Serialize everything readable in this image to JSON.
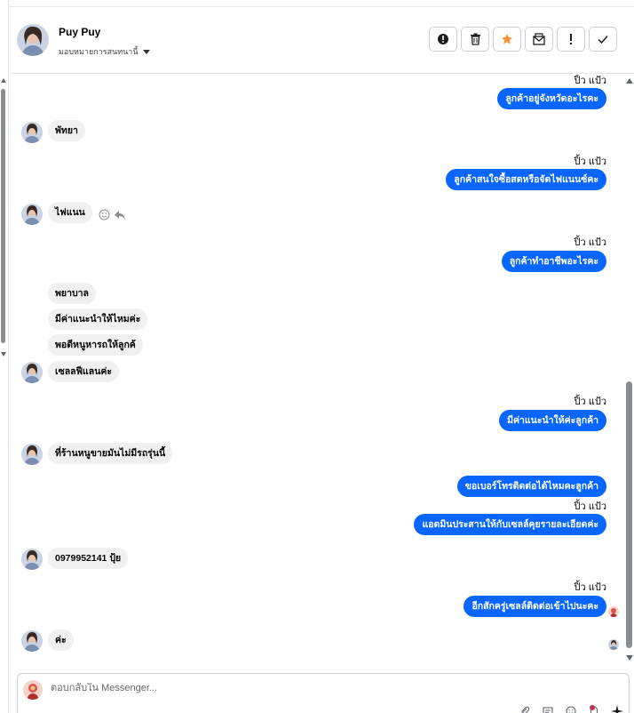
{
  "contact": {
    "name": "Puy Puy",
    "assign_label": "มอบหมายการสนทนานี้"
  },
  "actions": [
    {
      "name": "alert-button",
      "icon": "alert-circle-icon"
    },
    {
      "name": "delete-button",
      "icon": "trash-icon"
    },
    {
      "name": "star-button",
      "icon": "star-icon"
    },
    {
      "name": "mark-unread-button",
      "icon": "envelope-icon"
    },
    {
      "name": "flag-button",
      "icon": "exclamation-icon"
    },
    {
      "name": "done-button",
      "icon": "check-icon"
    }
  ],
  "thread": {
    "sender_name": "ปิ้ว แป้ว",
    "messages": [
      {
        "dir": "out",
        "sender": "ปิ้ว แป้ว",
        "text": "ลูกค้าอยู่จังหวัดอะไรคะ"
      },
      {
        "dir": "in",
        "text": "พัทยา"
      },
      {
        "dir": "out",
        "sender": "ปิ้ว แป้ว",
        "text": "ลูกค้าสนใจซื้อสดหรือจัดไฟแนนซ์คะ"
      },
      {
        "dir": "in",
        "text": "ไฟแนน"
      },
      {
        "dir": "out",
        "sender": "ปิ้ว แป้ว",
        "text": "ลูกค้าทำอาชีพอะไรคะ"
      },
      {
        "dir": "in",
        "text": "พยาบาล"
      },
      {
        "dir": "in",
        "text": "มีค่าแนะนำให้ไหมค่ะ"
      },
      {
        "dir": "in",
        "text": "พอดีหนูหารถให้ลูกค้"
      },
      {
        "dir": "in",
        "text": "เซลลฟีแลนค่ะ"
      },
      {
        "dir": "out",
        "sender": "ปิ้ว แป้ว",
        "text": "มีค่าแนะนำให้ค่ะลูกค้า"
      },
      {
        "dir": "in",
        "text": "ที่ร้านหนูขายมันไม่มีรถรุ่นนี้"
      },
      {
        "dir": "out",
        "text": "ขอเบอร์โทรติดต่อได้ไหมคะลูกค้า"
      },
      {
        "dir": "out",
        "sender": "ปิ้ว แป้ว",
        "text": "แอดมินประสานให้กับเซลล์คุยรายละเอียดค่ะ"
      },
      {
        "dir": "in",
        "text": "0979952141 ปุ้ย"
      },
      {
        "dir": "out",
        "sender": "ปิ้ว แป้ว",
        "text": "อีกสักครู่เซลล์ติดต่อเข้าไปนะคะ"
      },
      {
        "dir": "in",
        "text": "ค่ะ"
      }
    ]
  },
  "composer": {
    "placeholder": "ตอบกลับใน Messenger..."
  },
  "colors": {
    "outgoing_bubble": "#0866ff",
    "incoming_bubble": "#f0f0f0",
    "star": "#f7923b"
  }
}
